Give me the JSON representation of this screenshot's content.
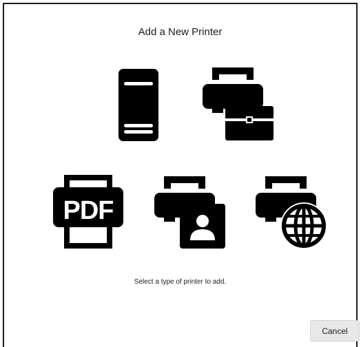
{
  "dialog": {
    "title": "Add a New Printer",
    "hint": "Select a type of printer to add.",
    "cancel_label": "Cancel"
  },
  "options": [
    {
      "icon": "server-icon"
    },
    {
      "icon": "printer-briefcase-icon"
    },
    {
      "icon": "pdf-printer-icon"
    },
    {
      "icon": "printer-contact-icon"
    },
    {
      "icon": "network-printer-icon"
    }
  ],
  "pdf_badge": "PDF",
  "colors": {
    "icon": "#000000",
    "background": "#ffffff",
    "border": "#1b1b1b",
    "button_bg": "#e8e8e8"
  }
}
